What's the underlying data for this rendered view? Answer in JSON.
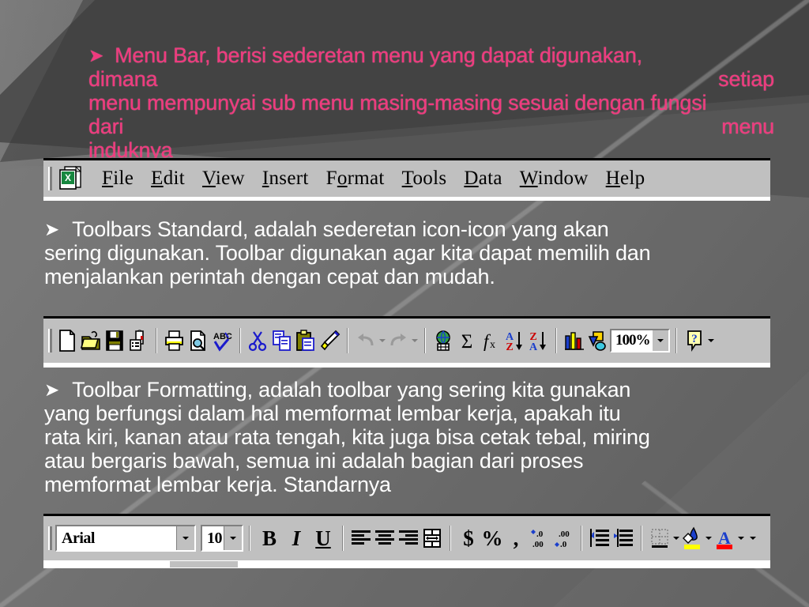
{
  "slide": {
    "background_dark": "#4e4e4e",
    "background_light": "#7c7c7c",
    "bullet_glyph": "➤"
  },
  "paragraph1": {
    "color": "#ef3a7e",
    "bullet": "➤",
    "line1": "Menu Bar, berisi sederetan menu yang dapat digunakan,",
    "line2_left": "dimana",
    "line2_right": "setiap",
    "line3": "menu mempunyai sub menu masing-masing sesuai dengan fungsi",
    "line4_left": "dari",
    "line4_right": "menu",
    "line5": "induknya"
  },
  "paragraph2": {
    "color": "#ffffff",
    "bullet": "➤",
    "line1": "Toolbars Standard, adalah sederetan icon-icon yang akan",
    "line2": "sering digunakan. Toolbar digunakan agar kita dapat memilih dan",
    "line3": "menjalankan perintah dengan cepat dan mudah."
  },
  "paragraph3": {
    "color": "#ffffff",
    "bullet": "➤",
    "line1": "Toolbar Formatting, adalah toolbar yang sering kita gunakan",
    "line2": "yang berfungsi dalam hal memformat lembar kerja, apakah itu",
    "line3": "rata kiri, kanan atau rata tengah, kita juga bisa cetak tebal, miring",
    "line4": "atau bergaris bawah, semua ini adalah bagian dari proses",
    "line5": "memformat lembar kerja. Standarnya"
  },
  "menubar": {
    "app_icon": "excel-document-icon",
    "items": [
      {
        "label": "File",
        "accel": "F",
        "rest": "ile"
      },
      {
        "label": "Edit",
        "accel": "E",
        "rest": "dit"
      },
      {
        "label": "View",
        "accel": "V",
        "rest": "iew"
      },
      {
        "label": "Insert",
        "accel": "I",
        "rest": "nsert"
      },
      {
        "label": "Format",
        "accel": "o",
        "pre": "F",
        "rest": "rmat"
      },
      {
        "label": "Tools",
        "accel": "T",
        "rest": "ools"
      },
      {
        "label": "Data",
        "accel": "D",
        "rest": "ata"
      },
      {
        "label": "Window",
        "accel": "W",
        "rest": "indow"
      },
      {
        "label": "Help",
        "accel": "H",
        "rest": "elp"
      }
    ]
  },
  "standard_toolbar": {
    "buttons": [
      "new-document-icon",
      "open-folder-icon",
      "save-floppy-icon",
      "email-icon",
      "print-icon",
      "print-preview-icon",
      "spelling-abc-check-icon",
      "cut-scissors-icon",
      "copy-icon",
      "paste-clipboard-icon",
      "format-painter-icon",
      "undo-icon",
      "redo-icon",
      "insert-hyperlink-globe-icon",
      "autosum-sigma-icon",
      "paste-function-fx-icon",
      "sort-ascending-az-icon",
      "sort-descending-za-icon",
      "chart-wizard-icon",
      "drawing-icon",
      "help-question-icon"
    ],
    "zoom_value": "100%",
    "zoom_dropdown": "chevron-down-icon",
    "overflow": "toolbar-overflow-icon"
  },
  "formatting_toolbar": {
    "font_name": "Arial",
    "font_size": "10",
    "bold_label": "B",
    "italic_label": "I",
    "underline_label": "U",
    "currency_label": "$",
    "percent_label": "%",
    "comma_label": ",",
    "buttons": [
      "align-left-icon",
      "align-center-icon",
      "align-right-icon",
      "merge-and-center-icon",
      "currency-style-icon",
      "percent-style-icon",
      "comma-style-icon",
      "increase-decimal-icon",
      "decrease-decimal-icon",
      "decrease-indent-icon",
      "increase-indent-icon",
      "borders-icon",
      "fill-color-icon",
      "font-color-icon",
      "toolbar-overflow-icon"
    ],
    "fill_color": "#ffff00",
    "font_color": "#ff0000"
  }
}
